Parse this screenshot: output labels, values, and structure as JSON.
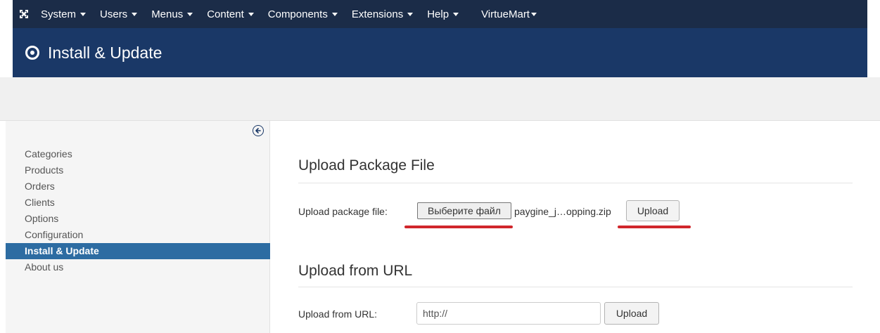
{
  "topbar": {
    "logo_icon": "joomla-logo-icon",
    "menus": [
      {
        "label": "System"
      },
      {
        "label": "Users"
      },
      {
        "label": "Menus"
      },
      {
        "label": "Content"
      },
      {
        "label": "Components"
      },
      {
        "label": "Extensions"
      },
      {
        "label": "Help"
      }
    ],
    "virtuemart_label": "VirtueMart",
    "background_color": "#1b2c48"
  },
  "header": {
    "icon": "target-circle-icon",
    "title": "Install & Update",
    "background_color": "#1a3867"
  },
  "sidebar": {
    "collapse_icon": "arrow-left-circle-icon",
    "items": [
      {
        "label": "Categories"
      },
      {
        "label": "Products"
      },
      {
        "label": "Orders"
      },
      {
        "label": "Clients"
      },
      {
        "label": "Options"
      },
      {
        "label": "Configuration"
      },
      {
        "label": "Install & Update"
      },
      {
        "label": "About us"
      }
    ],
    "active_item": "Install & Update",
    "active_color": "#2d6ca2"
  },
  "main": {
    "package_section": {
      "title": "Upload Package File",
      "field_label": "Upload package file:",
      "choose_file_label": "Выберите файл",
      "file_name": "paygine_j…opping.zip",
      "upload_label": "Upload"
    },
    "url_section": {
      "title": "Upload from URL",
      "field_label": "Upload from URL:",
      "url_value": "http://",
      "upload_label": "Upload"
    },
    "highlight_color": "#d0262b"
  }
}
